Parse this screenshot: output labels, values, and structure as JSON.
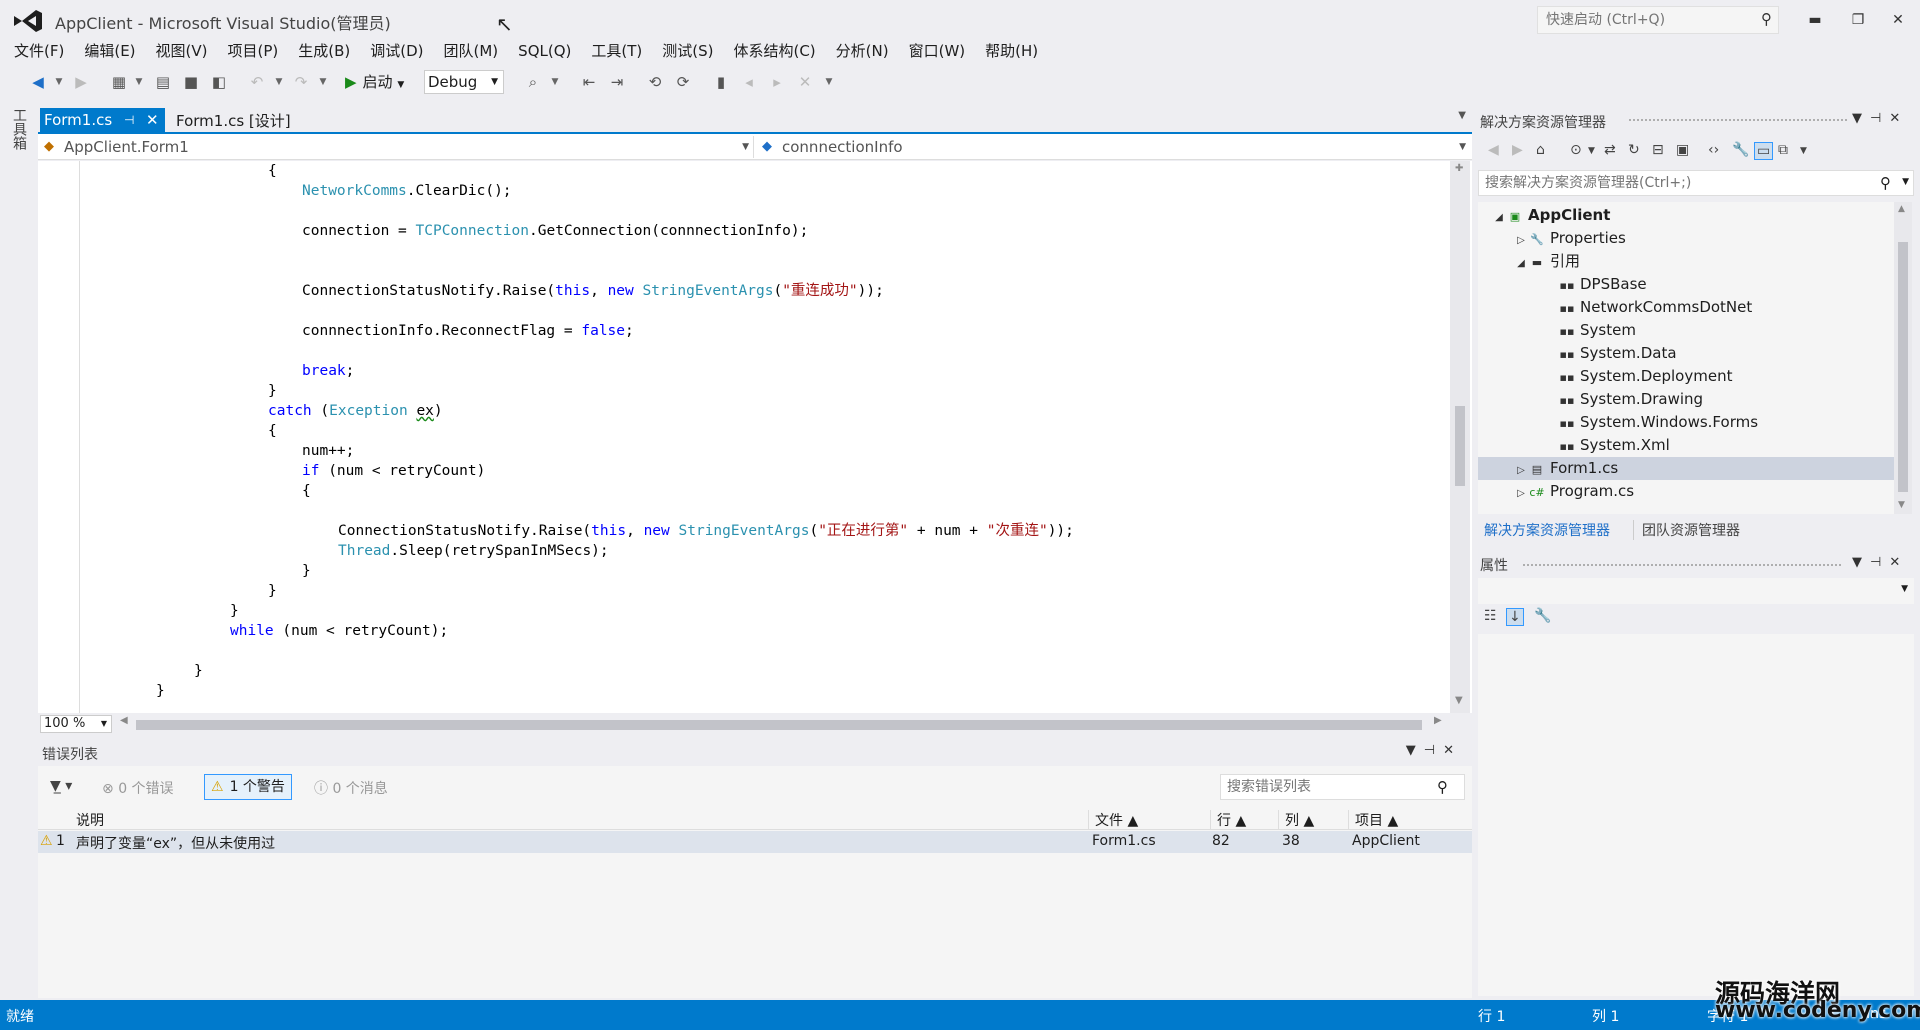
{
  "window": {
    "title": "AppClient - Microsoft Visual Studio(管理员)",
    "quick_launch_placeholder": "快速启动 (Ctrl+Q)",
    "minimize": "▬",
    "restore": "❐",
    "close": "✕"
  },
  "menu": [
    "文件(F)",
    "编辑(E)",
    "视图(V)",
    "项目(P)",
    "生成(B)",
    "调试(D)",
    "团队(M)",
    "SQL(Q)",
    "工具(T)",
    "测试(S)",
    "体系结构(C)",
    "分析(N)",
    "窗口(W)",
    "帮助(H)"
  ],
  "toolbar": {
    "start_label": "启动",
    "config_value": "Debug"
  },
  "toolbox_label": "工具箱",
  "editor": {
    "tabs": [
      {
        "label": "Form1.cs",
        "active": true
      },
      {
        "label": "Form1.cs [设计]",
        "active": false
      }
    ],
    "nav_class": "AppClient.Form1",
    "nav_member": "connnectionInfo",
    "zoom": "100 %"
  },
  "error_list": {
    "title": "错误列表",
    "errors_label": "0 个错误",
    "warnings_label": "1 个警告",
    "messages_label": "0 个消息",
    "search_placeholder": "搜索错误列表",
    "columns": {
      "desc": "说明",
      "file": "文件",
      "line": "行",
      "col": "列",
      "project": "项目"
    },
    "rows": [
      {
        "num": "1",
        "desc": "声明了变量“ex”，但从未使用过",
        "file": "Form1.cs",
        "line": "82",
        "col": "38",
        "project": "AppClient"
      }
    ]
  },
  "solution_explorer": {
    "title": "解决方案资源管理器",
    "search_placeholder": "搜索解决方案资源管理器(Ctrl+;)",
    "tree": {
      "root": "AppClient",
      "properties": "Properties",
      "references": "引用",
      "refs": [
        "DPSBase",
        "NetworkCommsDotNet",
        "System",
        "System.Data",
        "System.Deployment",
        "System.Drawing",
        "System.Windows.Forms",
        "System.Xml"
      ],
      "form1": "Form1.cs",
      "program": "Program.cs"
    },
    "tab_a": "解决方案资源管理器",
    "tab_b": "团队资源管理器"
  },
  "properties": {
    "title": "属性"
  },
  "status": {
    "ready": "就绪",
    "row": "行 1",
    "col": "列 1",
    "char": "字符 1",
    "mode": "Ins"
  },
  "watermark": {
    "line1": "源码海洋网",
    "line2": "www.codeny.com"
  },
  "colors": {
    "accent": "#007acc",
    "keyword": "#0000ff",
    "type": "#2b91af",
    "string": "#a31515"
  }
}
